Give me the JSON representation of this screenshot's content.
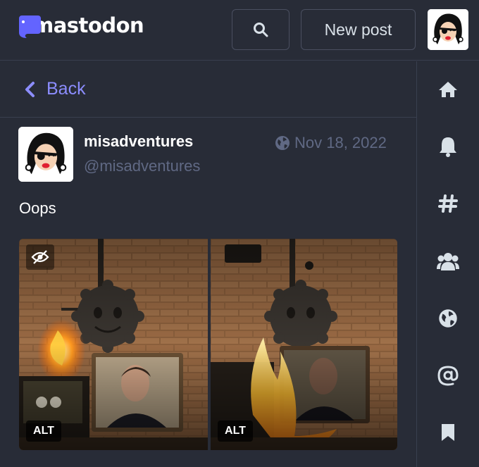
{
  "header": {
    "logo_text": "mastodon",
    "new_post_label": "New post",
    "search_icon": "search-icon"
  },
  "column": {
    "back_label": "Back"
  },
  "status": {
    "display_name": "misadventures",
    "account": "@misadventures",
    "date": "Nov 18, 2022",
    "content": "Oops",
    "media": [
      {
        "alt_label": "ALT"
      },
      {
        "alt_label": "ALT"
      }
    ]
  },
  "nav": {
    "items": [
      "home-icon",
      "bell-icon",
      "hashtag-icon",
      "people-icon",
      "globe-icon",
      "at-icon",
      "bookmark-icon"
    ]
  },
  "colors": {
    "background": "#282c37",
    "accent": "#8c8dff",
    "muted": "#606984",
    "border": "#393f4f"
  }
}
